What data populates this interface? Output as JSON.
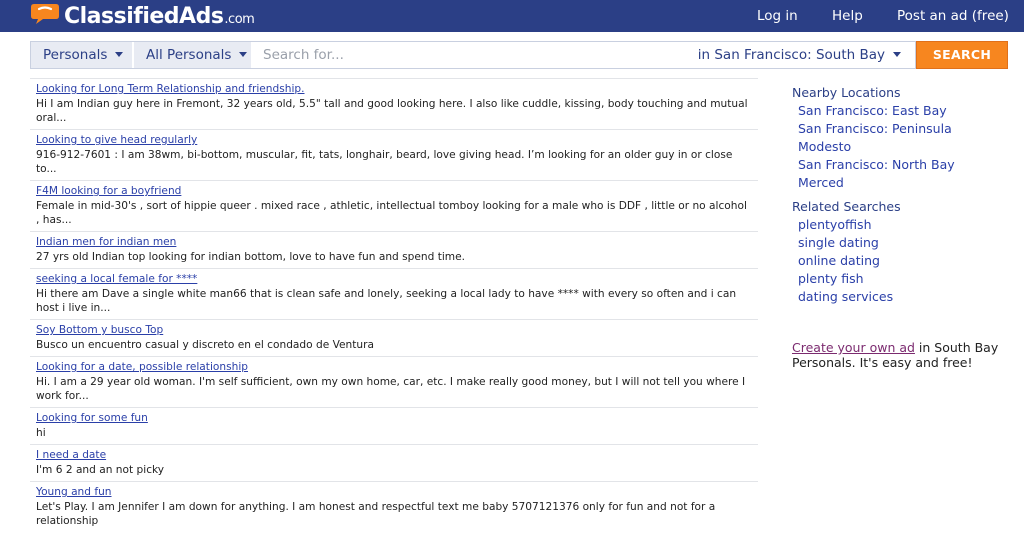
{
  "header": {
    "logo_main": "ClassifiedAds",
    "logo_tld": ".com",
    "nav": {
      "login": "Log in",
      "help": "Help",
      "post_ad": "Post an ad (free)"
    }
  },
  "search": {
    "category": "Personals",
    "subcategory": "All Personals",
    "placeholder": "Search for...",
    "location": "in San Francisco: South Bay",
    "button": "SEARCH"
  },
  "listings": [
    {
      "title": "Looking for Long Term Relationship and friendship.",
      "desc": "Hi I am Indian guy here in Fremont, 32 years old, 5.5\" tall and good looking here. I also like cuddle, kissing, body touching and mutual oral..."
    },
    {
      "title": "Looking to give head regularly",
      "desc": "916-912-7601 : I am 38wm, bi-bottom, muscular, fit, tats, longhair, beard, love giving head. I’m looking for an older guy in or close to..."
    },
    {
      "title": "F4M looking for a boyfriend",
      "desc": "Female in mid-30's , sort of hippie queer . mixed race , athletic, intellectual tomboy looking for a male who is DDF , little or no alcohol , has..."
    },
    {
      "title": "Indian men for indian men",
      "desc": "27 yrs old Indian top looking for indian bottom, love to have fun and spend time."
    },
    {
      "title": "seeking a local female for ****",
      "desc": "Hi there am Dave a single white man66 that is clean safe and lonely, seeking a local lady to have **** with every so often and i can host i live in..."
    },
    {
      "title": "Soy Bottom y busco Top",
      "desc": "Busco un encuentro casual y discreto en el condado de Ventura"
    },
    {
      "title": "Looking for a date, possible relationship",
      "desc": "Hi. I am a 29 year old woman. I'm self sufficient, own my own home, car, etc. I make really good money, but I will not tell you where I work for..."
    },
    {
      "title": "Looking for some fun",
      "desc": "hi"
    },
    {
      "title": "I need a date",
      "desc": "I'm 6 2 and an not picky"
    },
    {
      "title": "Young and fun",
      "desc": "Let's Play. I am Jennifer I am down for anything. I am honest and respectful text me baby 5707121376 only for fun and not for a relationship"
    }
  ],
  "sidebar": {
    "nearby_heading": "Nearby Locations",
    "nearby": [
      "San Francisco: East Bay",
      "San Francisco: Peninsula",
      "Modesto",
      "San Francisco: North Bay",
      "Merced"
    ],
    "related_heading": "Related Searches",
    "related": [
      "plentyoffish",
      "single dating",
      "online dating",
      "plenty fish",
      "dating services"
    ],
    "promo_link": "Create your own ad",
    "promo_text": " in South Bay Personals. It's easy and free!"
  },
  "colors": {
    "header_bg": "#2b3f86",
    "accent_orange": "#f7861f",
    "link_blue": "#2a3fa8",
    "visited_purple": "#7b2a6f"
  }
}
